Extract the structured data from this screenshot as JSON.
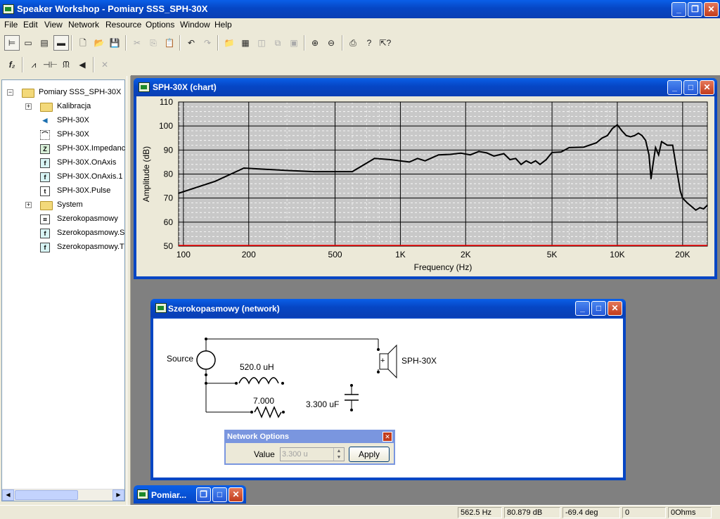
{
  "app": {
    "title": "Speaker Workshop - Pomiary SSS_SPH-30X"
  },
  "menu": [
    "File",
    "Edit",
    "View",
    "Network",
    "Resource",
    "Options",
    "Window",
    "Help"
  ],
  "toolbar_icons": [
    "tree-view",
    "list-view",
    "details-view",
    "small-view",
    "new",
    "open",
    "save",
    "cut",
    "copy",
    "paste",
    "undo",
    "redo",
    "open-folder",
    "chart",
    "graph",
    "frames",
    "panels",
    "zoom-in",
    "zoom-out",
    "print",
    "help",
    "context-help"
  ],
  "toolbar2_icons": [
    "fz",
    "resistor-wave",
    "capacitor",
    "inductor",
    "speaker",
    "delete"
  ],
  "toolbar2": {
    "fz_label": "f₂"
  },
  "tree": {
    "root": "Pomiary SSS_SPH-30X",
    "items": [
      {
        "label": "Kalibracja",
        "type": "folder",
        "expandable": true
      },
      {
        "label": "SPH-30X",
        "type": "driver"
      },
      {
        "label": "SPH-30X",
        "type": "enclosure"
      },
      {
        "label": "SPH-30X.Impedanc",
        "type": "impedance",
        "glyph": "Z"
      },
      {
        "label": "SPH-30X.OnAxis",
        "type": "frequency",
        "glyph": "f"
      },
      {
        "label": "SPH-30X.OnAxis.1",
        "type": "frequency",
        "glyph": "f"
      },
      {
        "label": "SPH-30X.Pulse",
        "type": "pulse",
        "glyph": "t"
      },
      {
        "label": "System",
        "type": "folder",
        "expandable": true
      },
      {
        "label": "Szerokopasmowy",
        "type": "network"
      },
      {
        "label": "Szerokopasmowy.S",
        "type": "frequency",
        "glyph": "f"
      },
      {
        "label": "Szerokopasmowy.T",
        "type": "frequency",
        "glyph": "f"
      }
    ]
  },
  "chart_window": {
    "title": "SPH-30X (chart)"
  },
  "chart_data": {
    "type": "line",
    "xlabel": "Frequency (Hz)",
    "ylabel": "Amplitude (dB)",
    "x_scale": "log",
    "xlim": [
      95,
      26000
    ],
    "ylim": [
      50,
      110
    ],
    "yticks": [
      50,
      60,
      70,
      80,
      90,
      100,
      110
    ],
    "xticks": [
      {
        "v": 100,
        "label": "100"
      },
      {
        "v": 200,
        "label": "200"
      },
      {
        "v": 500,
        "label": "500"
      },
      {
        "v": 1000,
        "label": "1K"
      },
      {
        "v": 2000,
        "label": "2K"
      },
      {
        "v": 5000,
        "label": "5K"
      },
      {
        "v": 10000,
        "label": "10K"
      },
      {
        "v": 20000,
        "label": "20K"
      }
    ],
    "grid": true,
    "series": [
      {
        "color": "#000000",
        "x": [
          95,
          140,
          190,
          300,
          400,
          600,
          760,
          900,
          1000,
          1100,
          1200,
          1300,
          1500,
          1700,
          1900,
          2100,
          2300,
          2500,
          2700,
          3000,
          3200,
          3400,
          3600,
          3800,
          4000,
          4200,
          4400,
          4700,
          5000,
          5500,
          6000,
          7000,
          8000,
          8500,
          9000,
          9500,
          10000,
          10500,
          11000,
          11500,
          12000,
          12500,
          13000,
          13500,
          14000,
          14300,
          14600,
          15000,
          15500,
          16000,
          17000,
          18000,
          19000,
          19500,
          20000,
          21000,
          22000,
          23000,
          24000,
          25000,
          26000
        ],
        "y": [
          72,
          77,
          82.5,
          81.5,
          81,
          81,
          86.5,
          86,
          85.5,
          85,
          86.5,
          85.5,
          88,
          88.2,
          88.7,
          88,
          89.4,
          88.8,
          87.5,
          88.5,
          86,
          86.5,
          84,
          85.5,
          84.5,
          85.5,
          84,
          86,
          89,
          89.2,
          91,
          91.2,
          93,
          95,
          96,
          99,
          100.5,
          98,
          96,
          95.5,
          96,
          97,
          96,
          94,
          88,
          78,
          84,
          91,
          88,
          93.5,
          92,
          92,
          79,
          73,
          70,
          68,
          66.5,
          65,
          66,
          65.5,
          67
        ]
      }
    ]
  },
  "network_window": {
    "title": "Szerokopasmowy (network)",
    "source_label": "Source",
    "inductor_label": "520.0 uH",
    "resistor_label": "7.000",
    "capacitor_label": "3.300 uF",
    "speaker_label": "SPH-30X",
    "speaker_plus": "+"
  },
  "network_options": {
    "title": "Network Options",
    "value_label": "Value",
    "value": "3.300 u",
    "apply_label": "Apply"
  },
  "minimized_window": {
    "title": "Pomiar..."
  },
  "status": [
    "562.5 Hz",
    "80.879 dB",
    "-69.4 deg",
    "0",
    "0Ohms"
  ],
  "colors": {
    "title_bar": "#0a5fe8",
    "chart_plot_bg": "#c8c8c8",
    "chart_trace": "#000000",
    "baseline_red": "#ff0000"
  }
}
